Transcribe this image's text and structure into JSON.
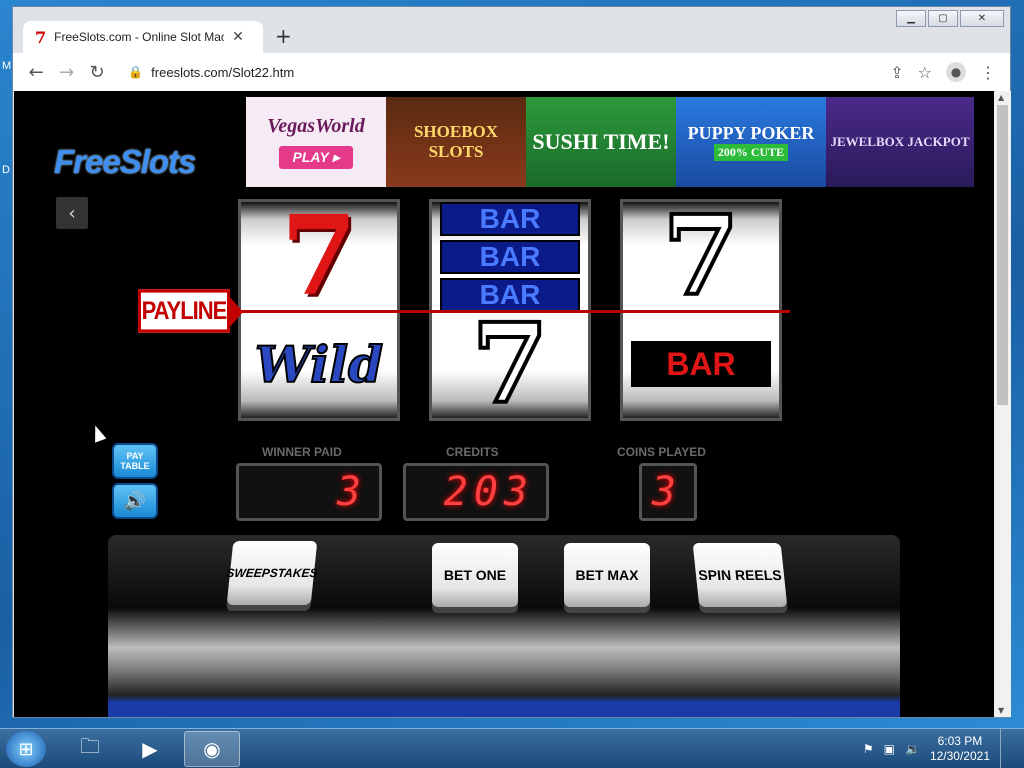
{
  "browser": {
    "tab_title": "FreeSlots.com - Online Slot Mach",
    "url": "freeslots.com/Slot22.htm"
  },
  "desktop": {
    "letters": [
      "M",
      "D"
    ]
  },
  "page": {
    "logo": "FreeSlots",
    "ads": {
      "vegasworld": "VegasWorld",
      "play": "PLAY ▸",
      "shoebox": "SHOEBOX SLOTS",
      "sushi": "SUSHI TIME!",
      "puppy": "PUPPY POKER",
      "puppy_pct": "200% CUTE",
      "jewelbox": "JEWELBOX JACKPOT"
    },
    "payline": "PAYLINE",
    "reels": {
      "r1_bottom": "Wild",
      "bar": "BAR",
      "r3_bottom": "BAR"
    },
    "labels": {
      "winner_paid": "WINNER PAID",
      "credits": "CREDITS",
      "coins_played": "COINS PLAYED"
    },
    "values": {
      "winner_paid": "3",
      "credits": "203",
      "coins_played": "3"
    },
    "buttons": {
      "pay_table": "PAY TABLE",
      "sweepstakes": "SWEEPSTAKES",
      "bet_one": "BET ONE",
      "bet_max": "BET MAX",
      "spin_reels": "SPIN REELS"
    }
  },
  "taskbar": {
    "time": "6:03 PM",
    "date": "12/30/2021"
  },
  "icons": [
    "seven-favicon-icon",
    "lock-icon",
    "share-icon",
    "star-icon",
    "profile-icon",
    "menu-icon",
    "back-arrow-icon",
    "forward-arrow-icon",
    "reload-icon",
    "chevron-left-icon",
    "speaker-icon",
    "windows-start-icon",
    "folder-icon",
    "media-player-icon",
    "chrome-icon",
    "flag-icon",
    "network-icon",
    "volume-icon"
  ]
}
